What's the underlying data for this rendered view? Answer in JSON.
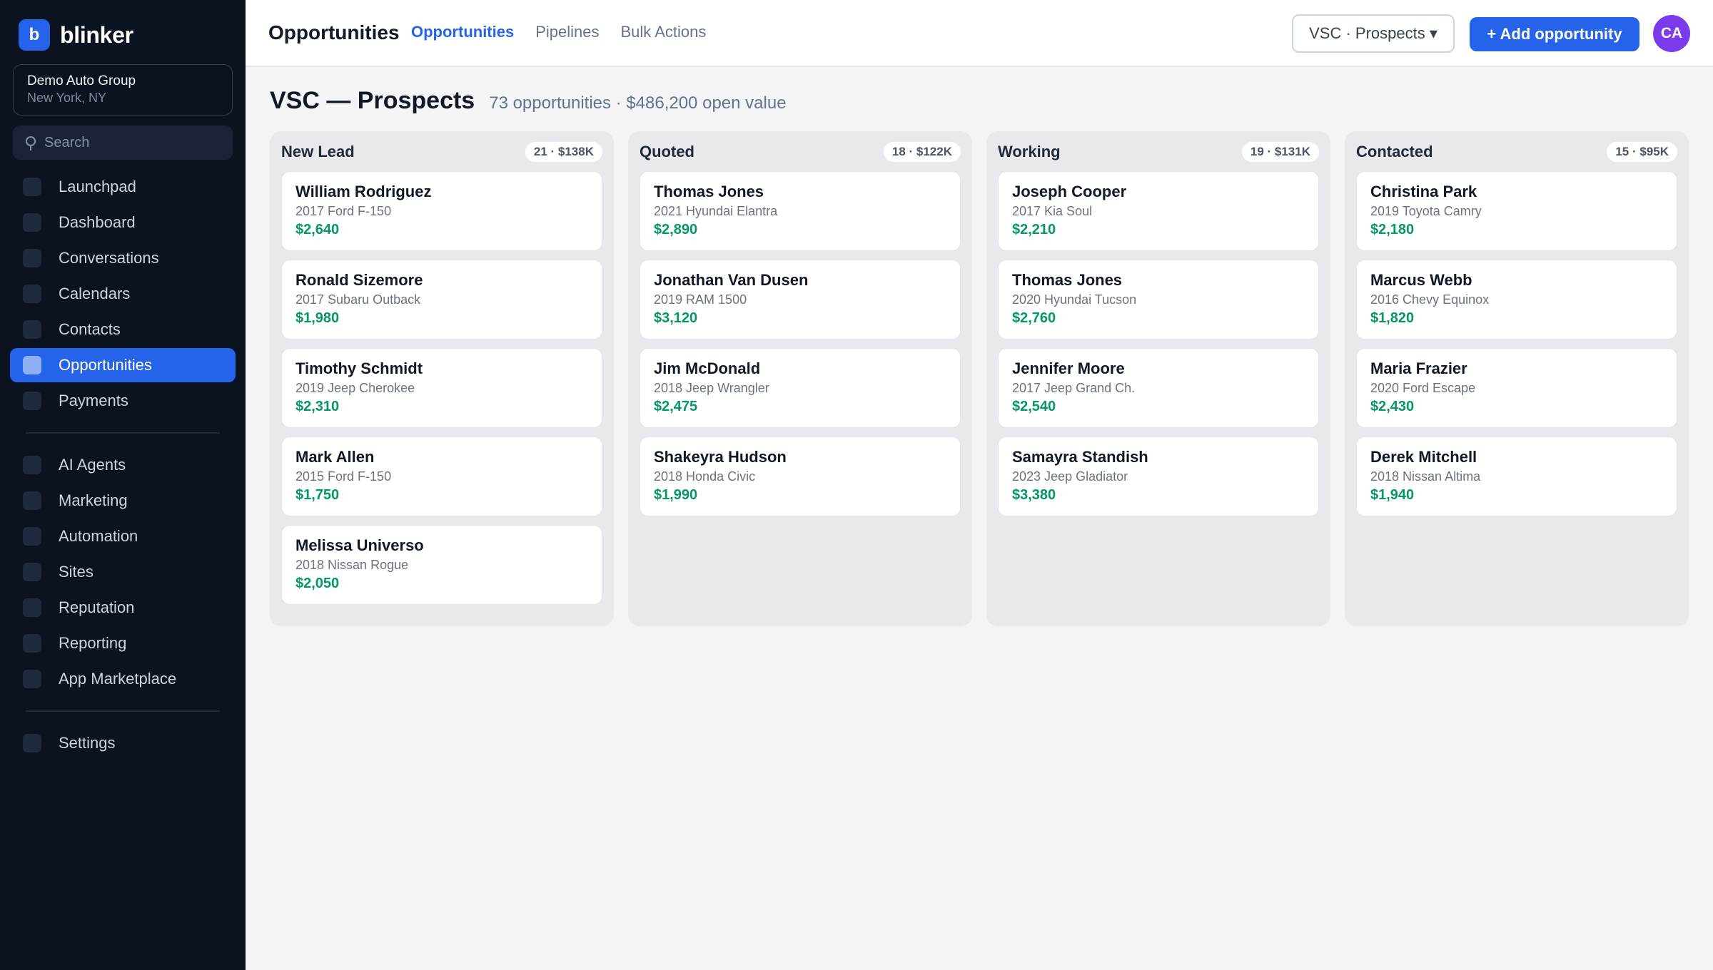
{
  "sidebar": {
    "brand_initial": "b",
    "brand_name": "blinker",
    "account_name": "Demo Auto Group",
    "account_location": "New York, NY",
    "search_placeholder": "Search",
    "nav_group1": [
      {
        "label": "Launchpad"
      },
      {
        "label": "Dashboard"
      },
      {
        "label": "Conversations"
      },
      {
        "label": "Calendars"
      },
      {
        "label": "Contacts"
      },
      {
        "label": "Opportunities",
        "active": true
      },
      {
        "label": "Payments"
      }
    ],
    "nav_group2": [
      {
        "label": "AI Agents"
      },
      {
        "label": "Marketing"
      },
      {
        "label": "Automation"
      },
      {
        "label": "Sites"
      },
      {
        "label": "Reputation"
      },
      {
        "label": "Reporting"
      },
      {
        "label": "App Marketplace"
      }
    ],
    "nav_group3": [
      {
        "label": "Settings"
      }
    ]
  },
  "topbar": {
    "title": "Opportunities",
    "tabs": [
      {
        "label": "Opportunities",
        "active": true
      },
      {
        "label": "Pipelines"
      },
      {
        "label": "Bulk Actions"
      }
    ],
    "pipeline_select": "VSC · Prospects ▾",
    "add_button": "+ Add opportunity",
    "avatar_initials": "CA"
  },
  "page": {
    "title": "VSC — Prospects",
    "subtitle": "73 opportunities · $486,200 open value"
  },
  "columns": [
    {
      "title": "New Lead",
      "badge": "21 · $138K",
      "cards": [
        {
          "name": "William Rodriguez",
          "vehicle": "2017 Ford F-150",
          "value": "$2,640"
        },
        {
          "name": "Ronald Sizemore",
          "vehicle": "2017 Subaru Outback",
          "value": "$1,980"
        },
        {
          "name": "Timothy Schmidt",
          "vehicle": "2019 Jeep Cherokee",
          "value": "$2,310"
        },
        {
          "name": "Mark Allen",
          "vehicle": "2015 Ford F-150",
          "value": "$1,750"
        },
        {
          "name": "Melissa Universo",
          "vehicle": "2018 Nissan Rogue",
          "value": "$2,050"
        }
      ]
    },
    {
      "title": "Quoted",
      "badge": "18 · $122K",
      "cards": [
        {
          "name": "Thomas Jones",
          "vehicle": "2021 Hyundai Elantra",
          "value": "$2,890"
        },
        {
          "name": "Jonathan Van Dusen",
          "vehicle": "2019 RAM 1500",
          "value": "$3,120"
        },
        {
          "name": "Jim McDonald",
          "vehicle": "2018 Jeep Wrangler",
          "value": "$2,475"
        },
        {
          "name": "Shakeyra Hudson",
          "vehicle": "2018 Honda Civic",
          "value": "$1,990"
        }
      ]
    },
    {
      "title": "Working",
      "badge": "19 · $131K",
      "cards": [
        {
          "name": "Joseph Cooper",
          "vehicle": "2017 Kia Soul",
          "value": "$2,210"
        },
        {
          "name": "Thomas Jones",
          "vehicle": "2020 Hyundai Tucson",
          "value": "$2,760"
        },
        {
          "name": "Jennifer Moore",
          "vehicle": "2017 Jeep Grand Ch.",
          "value": "$2,540"
        },
        {
          "name": "Samayra Standish",
          "vehicle": "2023 Jeep Gladiator",
          "value": "$3,380"
        }
      ]
    },
    {
      "title": "Contacted",
      "badge": "15 · $95K",
      "cards": [
        {
          "name": "Christina Park",
          "vehicle": "2019 Toyota Camry",
          "value": "$2,180"
        },
        {
          "name": "Marcus Webb",
          "vehicle": "2016 Chevy Equinox",
          "value": "$1,820"
        },
        {
          "name": "Maria Frazier",
          "vehicle": "2020 Ford Escape",
          "value": "$2,430"
        },
        {
          "name": "Derek Mitchell",
          "vehicle": "2018 Nissan Altima",
          "value": "$1,940"
        }
      ]
    }
  ]
}
